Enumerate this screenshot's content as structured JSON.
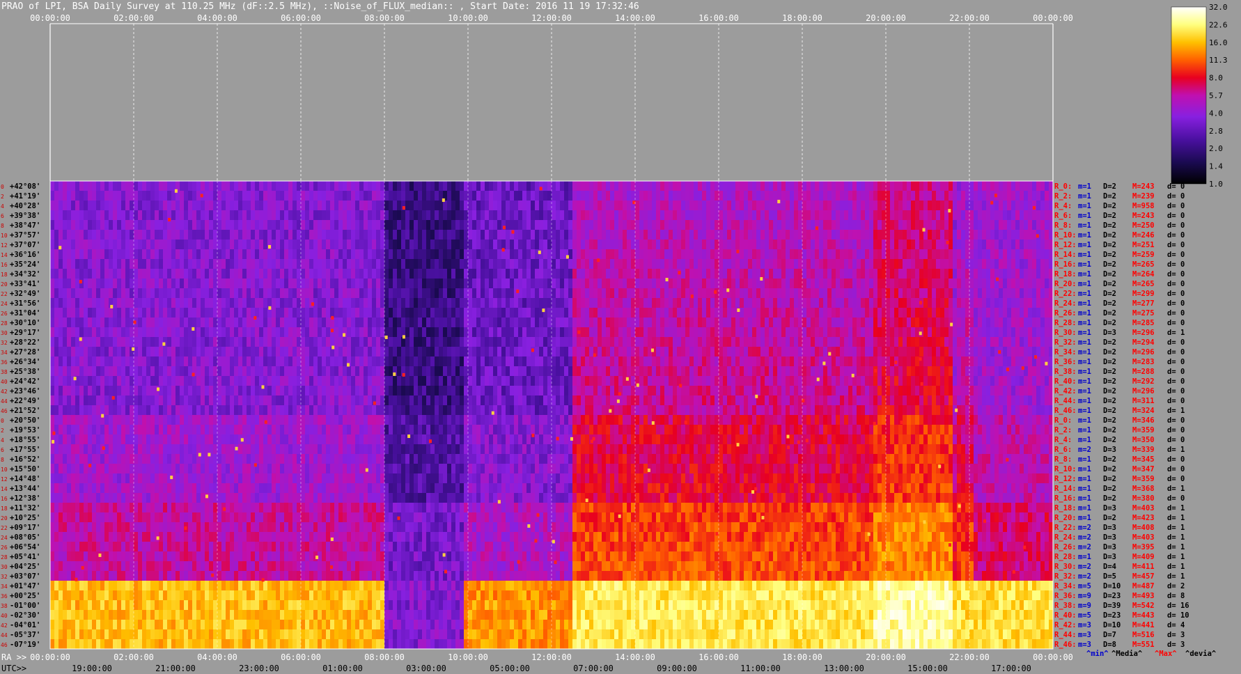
{
  "title": "PRAO of LPI, BSA Daily Survey at 110.25 MHz (dF::2.5 MHz), ::Noise_of_FLUX_median:: , Start Date: 2016 11 19 17:32:46",
  "chart_data": {
    "type": "heatmap",
    "title": "PRAO of LPI, BSA Daily Survey at 110.25 MHz (dF::2.5 MHz), ::Noise_of_FLUX_median:: , Start Date: 2016 11 19 17:32:46",
    "x_top_ticks": [
      "00:00:00",
      "02:00:00",
      "04:00:00",
      "06:00:00",
      "08:00:00",
      "10:00:00",
      "12:00:00",
      "14:00:00",
      "16:00:00",
      "18:00:00",
      "20:00:00",
      "22:00:00",
      "00:00:00"
    ],
    "x_bottom_label": "RA >>",
    "x_bottom_ticks": [
      "00:00:00",
      "02:00:00",
      "04:00:00",
      "06:00:00",
      "08:00:00",
      "10:00:00",
      "12:00:00",
      "14:00:00",
      "16:00:00",
      "18:00:00",
      "20:00:00",
      "22:00:00",
      "00:00:00"
    ],
    "utc_label": "UTC>>",
    "utc_ticks": [
      "19:00:00",
      "21:00:00",
      "23:00:00",
      "01:00:00",
      "03:00:00",
      "05:00:00",
      "07:00:00",
      "09:00:00",
      "11:00:00",
      "13:00:00",
      "15:00:00",
      "17:00:00"
    ],
    "declinations": [
      "+42°08'",
      "+41°19'",
      "+40°28'",
      "+39°38'",
      "+38°47'",
      "+37°57'",
      "+37°07'",
      "+36°16'",
      "+35°24'",
      "+34°32'",
      "+33°41'",
      "+32°49'",
      "+31°56'",
      "+31°04'",
      "+30°10'",
      "+29°17'",
      "+28°22'",
      "+27°28'",
      "+26°34'",
      "+25°38'",
      "+24°42'",
      "+23°46'",
      "+22°49'",
      "+21°52'",
      "+20°50'",
      "+19°53'",
      "+18°55'",
      "+17°55'",
      "+16°52'",
      "+15°50'",
      "+14°48'",
      "+13°44'",
      "+12°38'",
      "+11°32'",
      "+10°25'",
      "+09°17'",
      "+08°05'",
      "+06°54'",
      "+05°41'",
      "+04°25'",
      "+03°07'",
      "+01°47'",
      "+00°25'",
      "-01°00'",
      "-02°30'",
      "-04°01'",
      "-05°37'",
      "-07°19'"
    ],
    "row_indices": [
      "0",
      "2",
      "4",
      "6",
      "8",
      "10",
      "12",
      "14",
      "16",
      "18",
      "20",
      "22",
      "24",
      "26",
      "28",
      "30",
      "32",
      "34",
      "36",
      "38",
      "40",
      "42",
      "44",
      "46",
      "0",
      "2",
      "4",
      "6",
      "8",
      "10",
      "12",
      "14",
      "16",
      "18",
      "20",
      "22",
      "24",
      "26",
      "28",
      "30",
      "32",
      "34",
      "36",
      "38",
      "40",
      "42",
      "44",
      "46"
    ],
    "receivers": [
      {
        "r": "R_0:",
        "m": "m=1",
        "D": "D=2",
        "M": "M=243",
        "d": "d= 0"
      },
      {
        "r": "R_2:",
        "m": "m=1",
        "D": "D=2",
        "M": "M=239",
        "d": "d= 0"
      },
      {
        "r": "R_4:",
        "m": "m=1",
        "D": "D=2",
        "M": "M=958",
        "d": "d= 0"
      },
      {
        "r": "R_6:",
        "m": "m=1",
        "D": "D=2",
        "M": "M=243",
        "d": "d= 0"
      },
      {
        "r": "R_8:",
        "m": "m=1",
        "D": "D=2",
        "M": "M=250",
        "d": "d= 0"
      },
      {
        "r": "R_10:",
        "m": "m=1",
        "D": "D=2",
        "M": "M=246",
        "d": "d= 0"
      },
      {
        "r": "R_12:",
        "m": "m=1",
        "D": "D=2",
        "M": "M=251",
        "d": "d= 0"
      },
      {
        "r": "R_14:",
        "m": "m=1",
        "D": "D=2",
        "M": "M=259",
        "d": "d= 0"
      },
      {
        "r": "R_16:",
        "m": "m=1",
        "D": "D=2",
        "M": "M=265",
        "d": "d= 0"
      },
      {
        "r": "R_18:",
        "m": "m=1",
        "D": "D=2",
        "M": "M=264",
        "d": "d= 0"
      },
      {
        "r": "R_20:",
        "m": "m=1",
        "D": "D=2",
        "M": "M=265",
        "d": "d= 0"
      },
      {
        "r": "R_22:",
        "m": "m=1",
        "D": "D=2",
        "M": "M=299",
        "d": "d= 0"
      },
      {
        "r": "R_24:",
        "m": "m=1",
        "D": "D=2",
        "M": "M=277",
        "d": "d= 0"
      },
      {
        "r": "R_26:",
        "m": "m=1",
        "D": "D=2",
        "M": "M=275",
        "d": "d= 0"
      },
      {
        "r": "R_28:",
        "m": "m=1",
        "D": "D=2",
        "M": "M=285",
        "d": "d= 0"
      },
      {
        "r": "R_30:",
        "m": "m=1",
        "D": "D=3",
        "M": "M=296",
        "d": "d= 1"
      },
      {
        "r": "R_32:",
        "m": "m=1",
        "D": "D=2",
        "M": "M=294",
        "d": "d= 0"
      },
      {
        "r": "R_34:",
        "m": "m=1",
        "D": "D=2",
        "M": "M=296",
        "d": "d= 0"
      },
      {
        "r": "R_36:",
        "m": "m=1",
        "D": "D=2",
        "M": "M=283",
        "d": "d= 0"
      },
      {
        "r": "R_38:",
        "m": "m=1",
        "D": "D=2",
        "M": "M=288",
        "d": "d= 0"
      },
      {
        "r": "R_40:",
        "m": "m=1",
        "D": "D=2",
        "M": "M=292",
        "d": "d= 0"
      },
      {
        "r": "R_42:",
        "m": "m=1",
        "D": "D=2",
        "M": "M=296",
        "d": "d= 0"
      },
      {
        "r": "R_44:",
        "m": "m=1",
        "D": "D=2",
        "M": "M=311",
        "d": "d= 0"
      },
      {
        "r": "R_46:",
        "m": "m=1",
        "D": "D=2",
        "M": "M=324",
        "d": "d= 1"
      },
      {
        "r": "R_0:",
        "m": "m=1",
        "D": "D=2",
        "M": "M=346",
        "d": "d= 0"
      },
      {
        "r": "R_2:",
        "m": "m=1",
        "D": "D=2",
        "M": "M=359",
        "d": "d= 0"
      },
      {
        "r": "R_4:",
        "m": "m=1",
        "D": "D=2",
        "M": "M=350",
        "d": "d= 0"
      },
      {
        "r": "R_6:",
        "m": "m=2",
        "D": "D=3",
        "M": "M=339",
        "d": "d= 1"
      },
      {
        "r": "R_8:",
        "m": "m=1",
        "D": "D=2",
        "M": "M=345",
        "d": "d= 0"
      },
      {
        "r": "R_10:",
        "m": "m=1",
        "D": "D=2",
        "M": "M=347",
        "d": "d= 0"
      },
      {
        "r": "R_12:",
        "m": "m=1",
        "D": "D=2",
        "M": "M=359",
        "d": "d= 0"
      },
      {
        "r": "R_14:",
        "m": "m=1",
        "D": "D=2",
        "M": "M=368",
        "d": "d= 1"
      },
      {
        "r": "R_16:",
        "m": "m=1",
        "D": "D=2",
        "M": "M=380",
        "d": "d= 0"
      },
      {
        "r": "R_18:",
        "m": "m=1",
        "D": "D=3",
        "M": "M=403",
        "d": "d= 1"
      },
      {
        "r": "R_20:",
        "m": "m=1",
        "D": "D=2",
        "M": "M=423",
        "d": "d= 1"
      },
      {
        "r": "R_22:",
        "m": "m=2",
        "D": "D=3",
        "M": "M=408",
        "d": "d= 1"
      },
      {
        "r": "R_24:",
        "m": "m=2",
        "D": "D=3",
        "M": "M=403",
        "d": "d= 1"
      },
      {
        "r": "R_26:",
        "m": "m=2",
        "D": "D=3",
        "M": "M=395",
        "d": "d= 1"
      },
      {
        "r": "R_28:",
        "m": "m=1",
        "D": "D=3",
        "M": "M=409",
        "d": "d= 1"
      },
      {
        "r": "R_30:",
        "m": "m=2",
        "D": "D=4",
        "M": "M=411",
        "d": "d= 1"
      },
      {
        "r": "R_32:",
        "m": "m=2",
        "D": "D=5",
        "M": "M=457",
        "d": "d= 1"
      },
      {
        "r": "R_34:",
        "m": "m=5",
        "D": "D=10",
        "M": "M=487",
        "d": "d= 2"
      },
      {
        "r": "R_36:",
        "m": "m=9",
        "D": "D=23",
        "M": "M=493",
        "d": "d= 8"
      },
      {
        "r": "R_38:",
        "m": "m=9",
        "D": "D=39",
        "M": "M=542",
        "d": "d= 16"
      },
      {
        "r": "R_40:",
        "m": "m=5",
        "D": "D=23",
        "M": "M=443",
        "d": "d= 10"
      },
      {
        "r": "R_42:",
        "m": "m=3",
        "D": "D=10",
        "M": "M=441",
        "d": "d= 4"
      },
      {
        "r": "R_44:",
        "m": "m=3",
        "D": "D=7",
        "M": "M=516",
        "d": "d= 3"
      },
      {
        "r": "R_46:",
        "m": "m=3",
        "D": "D=8",
        "M": "M=551",
        "d": "d= 3"
      }
    ],
    "legend_footer": [
      "^min^",
      "^Media^",
      "^Max^",
      "^devia^"
    ],
    "colorbar": {
      "ticks": [
        "32.0",
        "22.6",
        "16.0",
        "11.3",
        "8.0",
        "5.7",
        "4.0",
        "2.8",
        "2.0",
        "1.4",
        "1.0"
      ],
      "colors": [
        "#000000",
        "#1a0a50",
        "#4a10a0",
        "#8820e0",
        "#c010b0",
        "#e80020",
        "#ff6000",
        "#ffc000",
        "#ffff80",
        "#ffffff"
      ]
    },
    "colors": {
      "background": "#9c9c9c",
      "min": "#0000cc",
      "media": "#000000",
      "max": "#ff0000",
      "devia": "#000000"
    }
  }
}
